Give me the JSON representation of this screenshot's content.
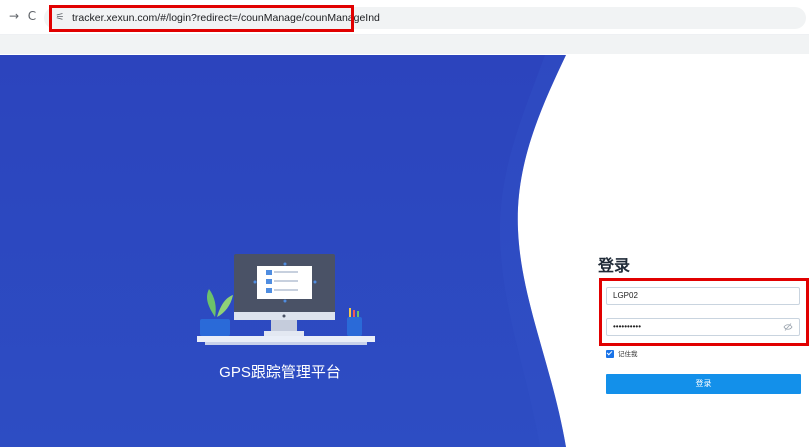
{
  "browser": {
    "back_icon": "→",
    "reload_icon": "C",
    "site_info_icon": "⚟",
    "url": "tracker.xexun.com/#/login?redirect=/counManage/counManageInd"
  },
  "hero": {
    "platform_title": "GPS跟踪管理平台",
    "colors": {
      "primary": "#2d46c0",
      "secondary": "#3150c6"
    }
  },
  "login": {
    "title": "登录",
    "username_value": "LGP02",
    "password_value": "••••••••••",
    "remember_label": "记住我",
    "remember_checked": true,
    "button_label": "登录"
  },
  "annotations": {
    "highlight_color": "#e10000"
  }
}
